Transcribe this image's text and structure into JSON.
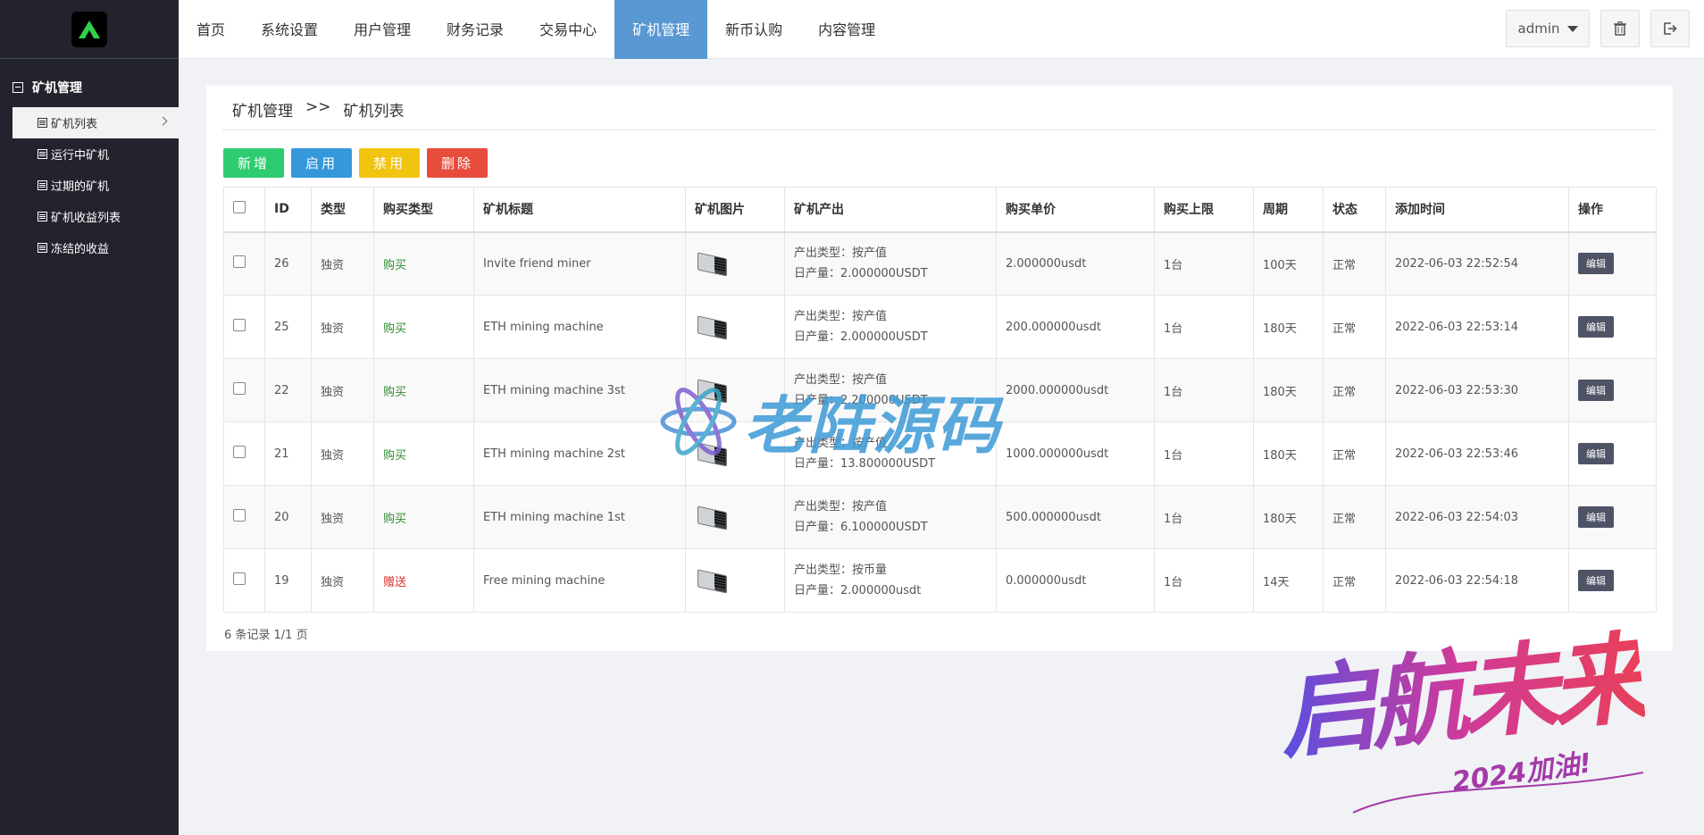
{
  "sidebar": {
    "group_title": "矿机管理",
    "items": [
      {
        "label": "矿机列表"
      },
      {
        "label": "运行中矿机"
      },
      {
        "label": "过期的矿机"
      },
      {
        "label": "矿机收益列表"
      },
      {
        "label": "冻结的收益"
      }
    ]
  },
  "topnav": {
    "items": [
      "首页",
      "系统设置",
      "用户管理",
      "财务记录",
      "交易中心",
      "矿机管理",
      "新币认购",
      "内容管理"
    ],
    "active": "矿机管理",
    "user": "admin"
  },
  "breadcrumb": {
    "parent": "矿机管理",
    "sep": ">>",
    "current": "矿机列表"
  },
  "actions": {
    "add": "新增",
    "enable": "启用",
    "disable": "禁用",
    "delete": "删除"
  },
  "table": {
    "headers": [
      "ID",
      "类型",
      "购买类型",
      "矿机标题",
      "矿机图片",
      "矿机产出",
      "购买单价",
      "购买上限",
      "周期",
      "状态",
      "添加时间",
      "操作"
    ],
    "rows": [
      {
        "id": "26",
        "type": "独资",
        "buy_type": "购买",
        "title": "Invite friend miner",
        "out1": "产出类型：按产值",
        "out2": "日产量：2.000000USDT",
        "price": "2.000000usdt",
        "limit": "1台",
        "cycle": "100天",
        "status": "正常",
        "time": "2022-06-03 22:52:54",
        "op": "编辑"
      },
      {
        "id": "25",
        "type": "独资",
        "buy_type": "购买",
        "title": "ETH mining machine",
        "out1": "产出类型：按产值",
        "out2": "日产量：2.000000USDT",
        "price": "200.000000usdt",
        "limit": "1台",
        "cycle": "180天",
        "status": "正常",
        "time": "2022-06-03 22:53:14",
        "op": "编辑"
      },
      {
        "id": "22",
        "type": "独资",
        "buy_type": "购买",
        "title": "ETH mining machine 3st",
        "out1": "产出类型：按产值",
        "out2": "日产量：2.200000USDT",
        "price": "2000.000000usdt",
        "limit": "1台",
        "cycle": "180天",
        "status": "正常",
        "time": "2022-06-03 22:53:30",
        "op": "编辑"
      },
      {
        "id": "21",
        "type": "独资",
        "buy_type": "购买",
        "title": "ETH mining machine 2st",
        "out1": "产出类型：按产值",
        "out2": "日产量：13.800000USDT",
        "price": "1000.000000usdt",
        "limit": "1台",
        "cycle": "180天",
        "status": "正常",
        "time": "2022-06-03 22:53:46",
        "op": "编辑"
      },
      {
        "id": "20",
        "type": "独资",
        "buy_type": "购买",
        "title": "ETH mining machine 1st",
        "out1": "产出类型：按产值",
        "out2": "日产量：6.100000USDT",
        "price": "500.000000usdt",
        "limit": "1台",
        "cycle": "180天",
        "status": "正常",
        "time": "2022-06-03 22:54:03",
        "op": "编辑"
      },
      {
        "id": "19",
        "type": "独资",
        "buy_type": "赠送",
        "title": "Free mining machine",
        "out1": "产出类型：按币量",
        "out2": "日产量：2.000000usdt",
        "price": "0.000000usdt",
        "limit": "1台",
        "cycle": "14天",
        "status": "正常",
        "time": "2022-06-03 22:54:18",
        "op": "编辑"
      }
    ]
  },
  "pager": "6 条记录 1/1 页",
  "watermarks": {
    "center": "老陆源码",
    "corner": "启航未来",
    "corner_sub": "2024加油!"
  },
  "colors": {
    "accent": "#5a98d4",
    "sidebar": "#23232e",
    "add": "#2ecc71",
    "enable": "#3498db",
    "disable": "#f1c40f",
    "delete": "#e74c3c"
  }
}
